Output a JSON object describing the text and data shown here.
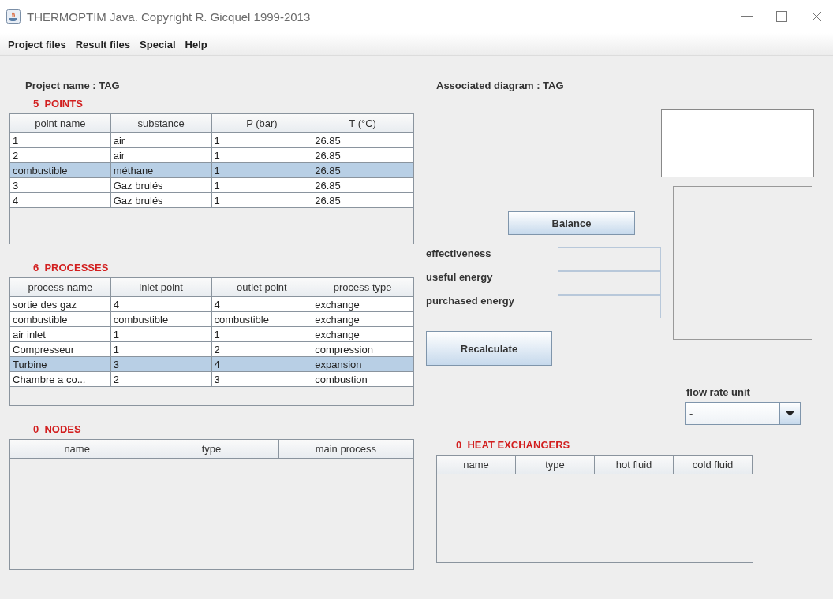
{
  "window": {
    "title": "THERMOPTIM Java. Copyright R. Gicquel 1999-2013"
  },
  "menu": [
    "Project files",
    "Result files",
    "Special",
    "Help"
  ],
  "project_name": "Project name : TAG",
  "points": {
    "heading": "5  POINTS",
    "columns": [
      "point name",
      "substance",
      "P (bar)",
      "T (°C)"
    ],
    "rows": [
      {
        "cells": [
          "1",
          "air",
          "1",
          "26.85"
        ],
        "selected": false
      },
      {
        "cells": [
          "2",
          "air",
          "1",
          "26.85"
        ],
        "selected": false
      },
      {
        "cells": [
          "combustible",
          "méthane",
          "1",
          "26.85"
        ],
        "selected": true
      },
      {
        "cells": [
          "3",
          "Gaz brulés",
          "1",
          "26.85"
        ],
        "selected": false
      },
      {
        "cells": [
          "4",
          "Gaz brulés",
          "1",
          "26.85"
        ],
        "selected": false
      }
    ]
  },
  "processes": {
    "heading": "6  PROCESSES",
    "columns": [
      "process name",
      "inlet point",
      "outlet point",
      "process type"
    ],
    "rows": [
      {
        "cells": [
          "sortie des gaz",
          "4",
          "4",
          "exchange"
        ],
        "selected": false
      },
      {
        "cells": [
          "combustible",
          "combustible",
          "combustible",
          "exchange"
        ],
        "selected": false
      },
      {
        "cells": [
          "air inlet",
          "1",
          "1",
          "exchange"
        ],
        "selected": false
      },
      {
        "cells": [
          "Compresseur",
          "1",
          "2",
          "compression"
        ],
        "selected": false
      },
      {
        "cells": [
          "Turbine",
          "3",
          "4",
          "expansion"
        ],
        "selected": true
      },
      {
        "cells": [
          "Chambre a co...",
          "2",
          "3",
          "combustion"
        ],
        "selected": false
      }
    ]
  },
  "nodes": {
    "heading": "0  NODES",
    "columns": [
      "name",
      "type",
      "main process"
    ]
  },
  "associated_diagram": "Associated diagram : TAG",
  "balance_button": "Balance",
  "results": [
    {
      "label": "effectiveness"
    },
    {
      "label": "useful energy"
    },
    {
      "label": "purchased energy"
    }
  ],
  "recalculate_button": "Recalculate",
  "flow_rate_unit": {
    "label": "flow rate unit",
    "value": "-"
  },
  "heat_exchangers": {
    "heading": "0  HEAT EXCHANGERS",
    "columns": [
      "name",
      "type",
      "hot fluid",
      "cold fluid"
    ]
  }
}
